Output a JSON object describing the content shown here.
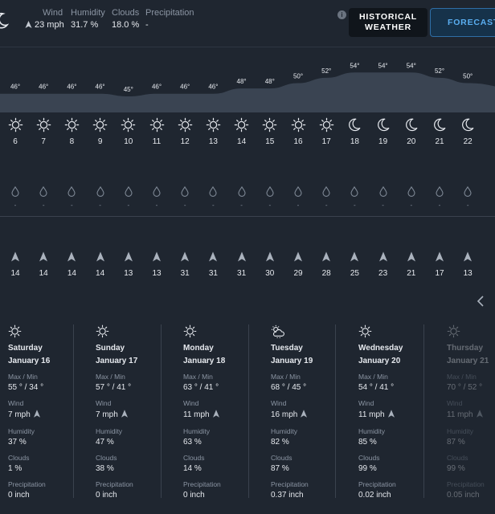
{
  "current": {
    "wind_label": "Wind",
    "wind_value": "23 mph",
    "humidity_label": "Humidity",
    "humidity_value": "31.7 %",
    "clouds_label": "Clouds",
    "clouds_value": "18.0 %",
    "precip_label": "Precipitation",
    "precip_value": "-"
  },
  "buttons": {
    "historical": "HISTORICAL WEATHER",
    "forecast": "FORECAST"
  },
  "hourly": {
    "temps": [
      "46°",
      "46°",
      "46°",
      "46°",
      "45°",
      "46°",
      "46°",
      "46°",
      "48°",
      "48°",
      "50°",
      "52°",
      "54°",
      "54°",
      "54°",
      "52°",
      "50°"
    ],
    "temp_values": [
      46,
      46,
      46,
      46,
      45,
      46,
      46,
      46,
      48,
      48,
      50,
      52,
      54,
      54,
      54,
      52,
      50
    ],
    "hours": [
      "6",
      "7",
      "8",
      "9",
      "10",
      "11",
      "12",
      "13",
      "14",
      "15",
      "16",
      "17",
      "18",
      "19",
      "20",
      "21",
      "22"
    ],
    "icons": [
      "sun-icon",
      "sun-icon",
      "sun-icon",
      "sun-icon",
      "sun-icon",
      "sun-icon",
      "sun-icon",
      "sun-icon",
      "sun-icon",
      "sun-icon",
      "sun-icon",
      "sun-icon",
      "moon-icon",
      "moon-icon",
      "moon-icon",
      "moon-icon",
      "moon-icon"
    ],
    "precip": [
      "-",
      "-",
      "-",
      "-",
      "-",
      "-",
      "-",
      "-",
      "-",
      "-",
      "-",
      "-",
      "-",
      "-",
      "-",
      "-",
      "-"
    ],
    "wind": [
      "14",
      "14",
      "14",
      "14",
      "13",
      "13",
      "31",
      "31",
      "31",
      "30",
      "29",
      "28",
      "25",
      "23",
      "21",
      "17",
      "13"
    ]
  },
  "daily": [
    {
      "icon": "sun-icon",
      "day": "Saturday",
      "date": "January 16",
      "maxmin_label": "Max / Min",
      "maxmin": "55 ° / 34 °",
      "wind_label": "Wind",
      "wind": "7 mph",
      "humidity_label": "Humidity",
      "humidity": "37 %",
      "clouds_label": "Clouds",
      "clouds": "1 %",
      "precip_label": "Precipitation",
      "precip": "0 inch"
    },
    {
      "icon": "sun-icon",
      "day": "Sunday",
      "date": "January 17",
      "maxmin_label": "Max / Min",
      "maxmin": "57 ° / 41 °",
      "wind_label": "Wind",
      "wind": "7 mph",
      "humidity_label": "Humidity",
      "humidity": "47 %",
      "clouds_label": "Clouds",
      "clouds": "38 %",
      "precip_label": "Precipitation",
      "precip": "0 inch"
    },
    {
      "icon": "sun-icon",
      "day": "Monday",
      "date": "January 18",
      "maxmin_label": "Max / Min",
      "maxmin": "63 ° / 41 °",
      "wind_label": "Wind",
      "wind": "11 mph",
      "humidity_label": "Humidity",
      "humidity": "63 %",
      "clouds_label": "Clouds",
      "clouds": "14 %",
      "precip_label": "Precipitation",
      "precip": "0 inch"
    },
    {
      "icon": "sun-cloud-rain-icon",
      "day": "Tuesday",
      "date": "January 19",
      "maxmin_label": "Max / Min",
      "maxmin": "68 ° / 45 °",
      "wind_label": "Wind",
      "wind": "16 mph",
      "humidity_label": "Humidity",
      "humidity": "82 %",
      "clouds_label": "Clouds",
      "clouds": "87 %",
      "precip_label": "Precipitation",
      "precip": "0.37 inch"
    },
    {
      "icon": "sun-icon",
      "day": "Wednesday",
      "date": "January 20",
      "maxmin_label": "Max / Min",
      "maxmin": "54 ° / 41 °",
      "wind_label": "Wind",
      "wind": "11 mph",
      "humidity_label": "Humidity",
      "humidity": "85 %",
      "clouds_label": "Clouds",
      "clouds": "99 %",
      "precip_label": "Precipitation",
      "precip": "0.02 inch"
    },
    {
      "icon": "sun-icon",
      "day": "Thursday",
      "date": "January 21",
      "maxmin_label": "Max / Min",
      "maxmin": "70 ° / 52 °",
      "wind_label": "Wind",
      "wind": "11 mph",
      "humidity_label": "Humidity",
      "humidity": "87 %",
      "clouds_label": "Clouds",
      "clouds": "99 %",
      "precip_label": "Precipitation",
      "precip": "0.05 inch"
    }
  ]
}
